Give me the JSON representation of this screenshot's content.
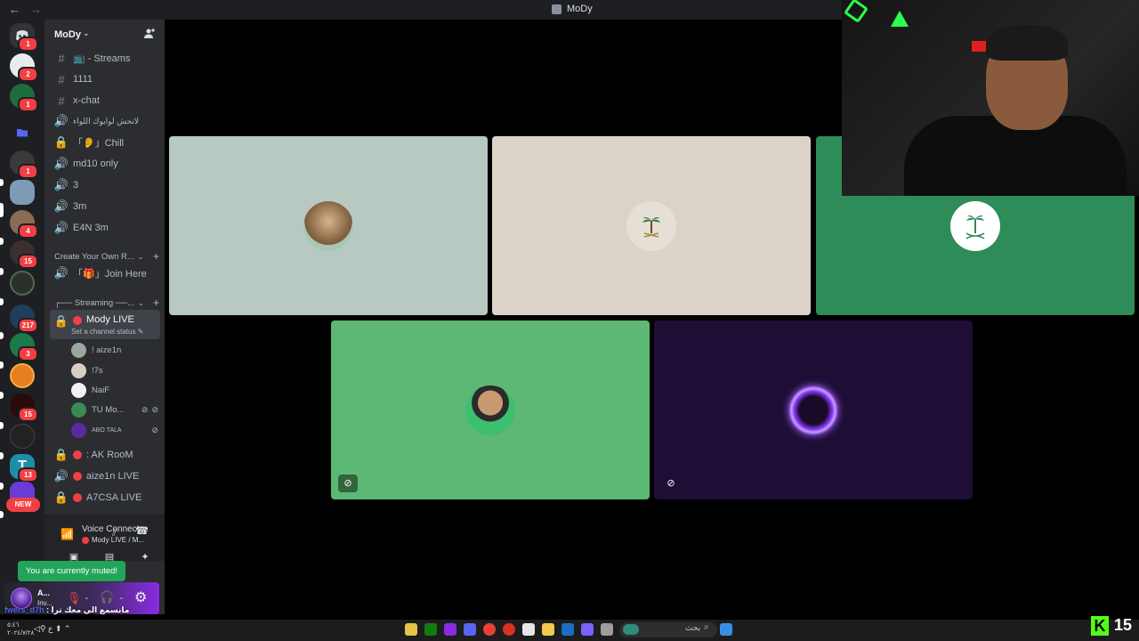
{
  "window": {
    "title": "MoDy"
  },
  "rail": {
    "servers": [
      {
        "name": "discord-home",
        "badge": "1"
      },
      {
        "name": "server-palm",
        "badge": "2"
      },
      {
        "name": "server-gears",
        "badge": "1"
      },
      {
        "name": "server-folder",
        "badge": ""
      },
      {
        "name": "server-dark",
        "badge": "1"
      },
      {
        "name": "server-mody",
        "badge": ""
      },
      {
        "name": "server-face",
        "badge": "4"
      },
      {
        "name": "server-mask",
        "badge": "15"
      },
      {
        "name": "server-hhkr",
        "badge": ""
      },
      {
        "name": "server-blue",
        "badge": "217"
      },
      {
        "name": "server-ball",
        "badge": "3"
      },
      {
        "name": "server-eye",
        "badge": ""
      },
      {
        "name": "server-red",
        "badge": "15"
      },
      {
        "name": "server-logo",
        "badge": ""
      },
      {
        "name": "server-t",
        "badge": "13"
      },
      {
        "name": "server-ni",
        "badge": ""
      }
    ],
    "new_label": "NEW"
  },
  "guild": {
    "name": "MoDy"
  },
  "channels": {
    "streams": "📺 - Streams",
    "c1111": "1111",
    "xchat": "x-chat",
    "arabic": "لاتحش لوابوك اللواء",
    "chill": "「👂」Chill",
    "md10": "md10 only",
    "three": "3",
    "threem": "3m",
    "e4n": "E4N 3m",
    "category_create": "Create Your Own R...",
    "join_here": "「🎁」Join Here",
    "category_streaming": "┌── Streaming ──...",
    "mody_live": "Mody LIVE",
    "status_placeholder": "Set a channel status",
    "ak_room": ": AK RooM",
    "aize_live": "aize1n LIVE",
    "a7csa_live": "A7CSA LIVE"
  },
  "voice_users": [
    {
      "name": "! aize1n"
    },
    {
      "name": "!7s"
    },
    {
      "name": "NaiF"
    },
    {
      "name": "TU Mo..."
    },
    {
      "name": "ABO TALA"
    }
  ],
  "voice_panel": {
    "title": "Voice Connected",
    "subtitle": "Mody LIVE / M..."
  },
  "tooltip": {
    "muted": "You are currently muted!"
  },
  "user": {
    "name": "A...",
    "status": "Inv..."
  },
  "overlay": {
    "handle": "fwers_d7h",
    "message": ": مانسمع الي معك ترا"
  },
  "taskbar": {
    "search_label": "بحث",
    "clock_time": "٥:٤٦",
    "clock_date": "٢٠٢٤/٧/٢٨"
  },
  "kick": {
    "viewers": "15"
  },
  "colors": {
    "tile1": "#b7c9c0",
    "tile2": "#dbd3c8",
    "tile3": "#2d8c57",
    "tile4": "#5cb873",
    "tile5": "#1e0e36",
    "accent": "#5865f2",
    "danger": "#f23f43"
  }
}
